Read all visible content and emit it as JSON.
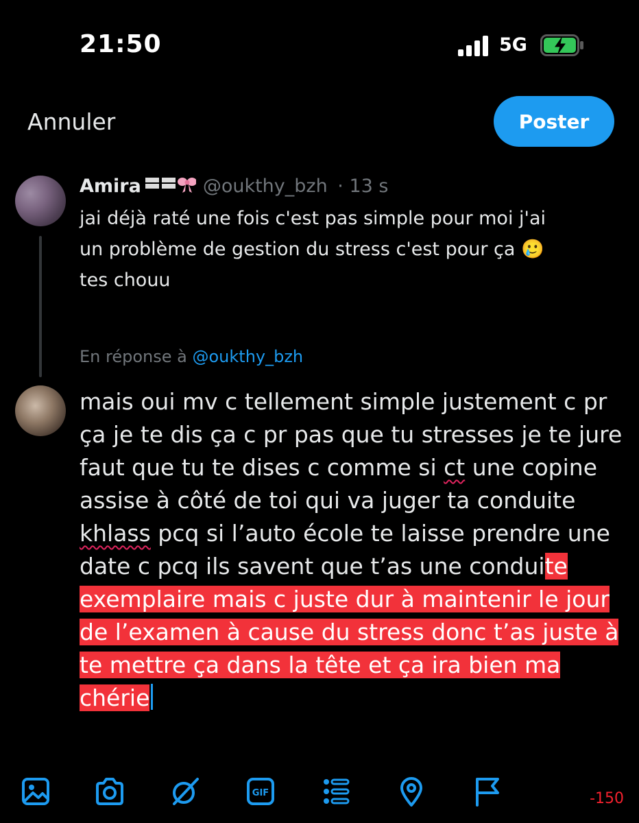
{
  "status": {
    "time": "21:50",
    "network": "5G",
    "battery_state": "charging",
    "signal": "full"
  },
  "header": {
    "cancel_label": "Annuler",
    "post_label": "Poster"
  },
  "original_tweet": {
    "name": "Amira",
    "badge": "🏳️🏳️🎀",
    "handle": "@oukthy_bzh",
    "time": "· 13 s",
    "text_lines": [
      "jai déjà raté une fois c'est pas simple pour moi j'ai",
      "un problème de gestion du stress c'est pour ça 🥲",
      "tes chouu"
    ]
  },
  "reply": {
    "prefix": "En réponse à",
    "handle": "@oukthy_bzh"
  },
  "compose": {
    "text_plain_a": "mais oui mv c tellement simple justement c pr ça je te dis ça c pr pas que tu stresses je te jure faut que tu te dises c comme si ",
    "misspelled_1": "ct",
    "text_plain_b": " une copine assise à côté de toi qui va juger ta conduite ",
    "misspelled_2": "khlass",
    "text_plain_c": " pcq si l’auto école te laisse prendre une date c pcq ils savent que t’as une condui",
    "text_highlighted": "te exemplaire mais c juste dur à maintenir le jour de l’examen à cause du stress donc t’as juste à te mettre ça dans la tête et ça ira bien ma chérie"
  },
  "toolbar": {
    "icons": [
      "image-icon",
      "camera-icon",
      "grok-icon",
      "gif-icon",
      "poll-icon",
      "location-icon",
      "flag-icon"
    ],
    "char_count": "-150"
  },
  "colors": {
    "accent": "#1d9bf0",
    "highlight": "#f2323a",
    "muted": "#71767b",
    "error": "#f4212e"
  }
}
